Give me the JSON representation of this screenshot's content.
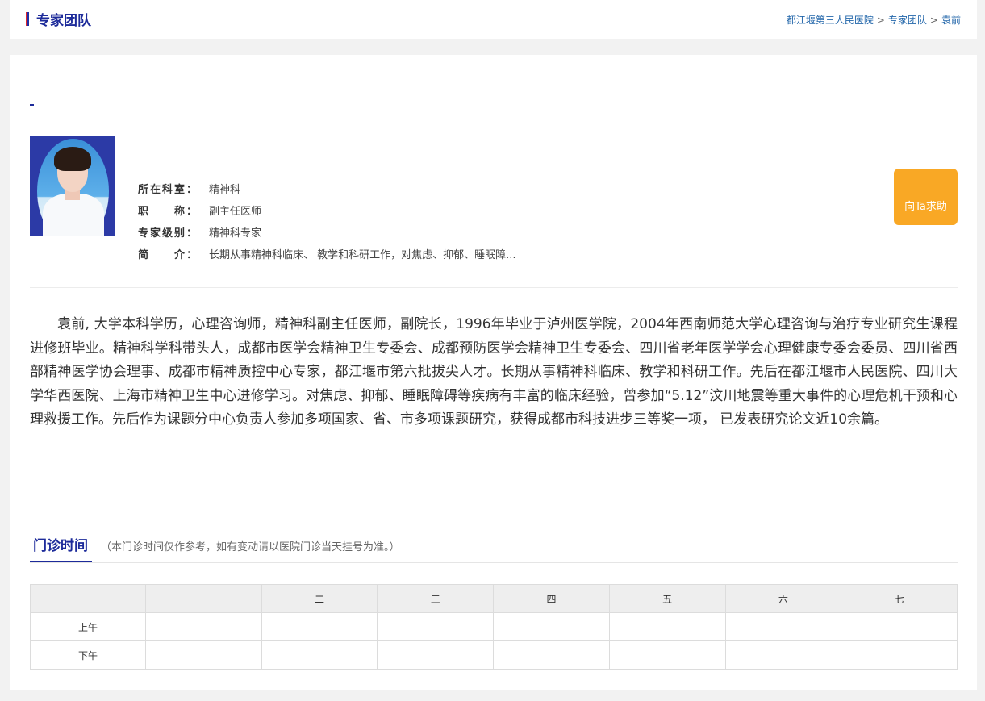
{
  "header": {
    "title": "专家团队",
    "breadcrumb": [
      "都江堰第三人民医院",
      "专家团队",
      "袁前"
    ],
    "breadcrumb_sep": ">"
  },
  "doctor": {
    "fields": [
      {
        "label": "所在科室：",
        "value": "精神科"
      },
      {
        "label": "职　　称：",
        "value": "副主任医师"
      },
      {
        "label": "专家级别：",
        "value": "精神科专家"
      },
      {
        "label": "简　　介：",
        "value": "长期从事精神科临床、 教学和科研工作，对焦虑、抑郁、睡眠障..."
      }
    ],
    "help_button": "向Ta求助",
    "bio": "袁前, 大学本科学历，心理咨询师，精神科副主任医师，副院长，1996年毕业于泸州医学院，2004年西南师范大学心理咨询与治疗专业研究生课程进修班毕业。精神科学科带头人，成都市医学会精神卫生专委会、成都预防医学会精神卫生专委会、四川省老年医学学会心理健康专委会委员、四川省西部精神医学协会理事、成都市精神质控中心专家，都江堰市第六批拔尖人才。长期从事精神科临床、教学和科研工作。先后在都江堰市人民医院、四川大学华西医院、上海市精神卫生中心进修学习。对焦虑、抑郁、睡眠障碍等疾病有丰富的临床经验，曾参加“5.12”汶川地震等重大事件的心理危机干预和心理救援工作。先后作为课题分中心负责人参加多项国家、省、市多项课题研究，获得成都市科技进步三等奖一项， 已发表研究论文近10余篇。"
  },
  "schedule": {
    "title": "门诊时间",
    "note": "（本门诊时间仅作参考，如有变动请以医院门诊当天挂号为准。）",
    "days": [
      "一",
      "二",
      "三",
      "四",
      "五",
      "六",
      "七"
    ],
    "rows": [
      "上午",
      "下午"
    ]
  },
  "colors": {
    "accent": "#1d2b9a",
    "button": "#f9a825"
  }
}
